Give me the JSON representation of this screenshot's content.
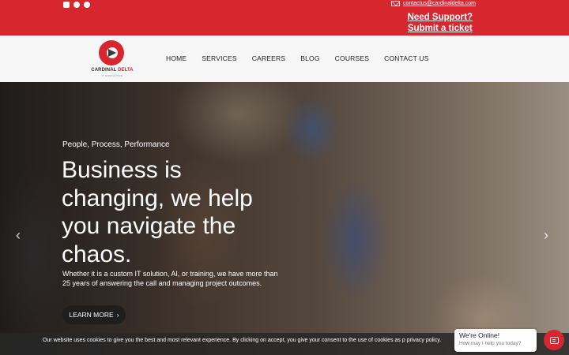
{
  "topbar": {
    "social_icons": [
      "instagram-icon",
      "facebook-icon",
      "linkedin-icon"
    ],
    "email": "contactus@cardinaldelta.com",
    "support_line1": "Need Support?",
    "support_line2": "Submit a ticket",
    "background": "#d7262e"
  },
  "logo": {
    "name_part1": "CARDINAL",
    "name_part2": "DELTA",
    "sub": "IT CONSULTING"
  },
  "nav": {
    "items": [
      "HOME",
      "SERVICES",
      "CAREERS",
      "BLOG",
      "COURSES",
      "CONTACT US"
    ]
  },
  "hero": {
    "eyebrow": "People, Process, Performance",
    "headline": "Business is changing, we help you navigate the chaos.",
    "description": "Whether it is a custom IT solution, AI, or training, we have more than 25 years of answering the call and managing project outcomes.",
    "cta_label": "LEARN MORE",
    "cta_arrow": "›",
    "prev_arrow": "‹",
    "next_arrow": "›"
  },
  "cookie": {
    "text": "Our website uses cookies to give you the best and most relevant experience. By clicking on accept, you give your consent to the use of cookies as p privacy policy."
  },
  "chat": {
    "title": "We're Online!",
    "subtitle": "How may I help you today?",
    "accent": "#d7262e"
  }
}
